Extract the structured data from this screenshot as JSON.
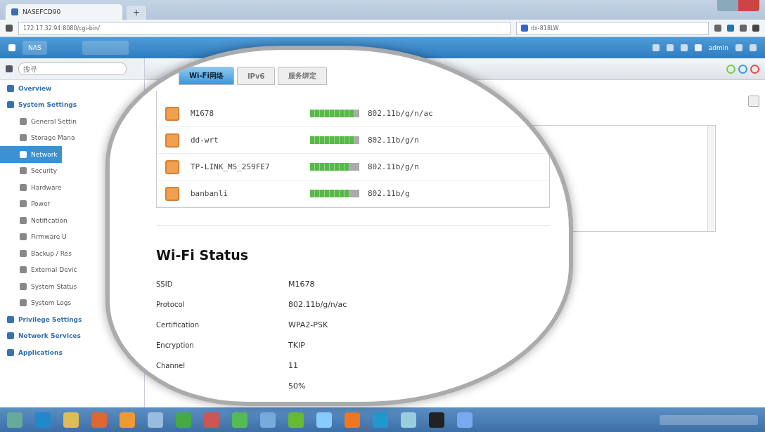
{
  "browser": {
    "tab_title": "NASEFCD90",
    "new_tab": "+",
    "url": "172.17.32.94:8080/cgi-bin/",
    "search": "dx-818LW"
  },
  "appbar": {
    "home": "NAS",
    "user": "admin"
  },
  "sidebar": {
    "search_placeholder": "搜寻",
    "items": [
      {
        "label": "Overview",
        "selected": false
      },
      {
        "label": "System Settings",
        "selected": false,
        "children": [
          {
            "label": "General Settin",
            "selected": false
          },
          {
            "label": "Storage Mana",
            "selected": false
          },
          {
            "label": "Network",
            "selected": true
          },
          {
            "label": "Security",
            "selected": false
          },
          {
            "label": "Hardware",
            "selected": false
          },
          {
            "label": "Power",
            "selected": false
          },
          {
            "label": "Notification",
            "selected": false
          },
          {
            "label": "Firmware U",
            "selected": false
          },
          {
            "label": "Backup / Res",
            "selected": false
          },
          {
            "label": "External Devic",
            "selected": false
          },
          {
            "label": "System Status",
            "selected": false
          },
          {
            "label": "System Logs",
            "selected": false
          }
        ]
      },
      {
        "label": "Privilege Settings",
        "selected": false
      },
      {
        "label": "Network Services",
        "selected": false
      },
      {
        "label": "Applications",
        "selected": false
      }
    ]
  },
  "tabs": [
    {
      "label": "Wi-Fi网络",
      "selected": true
    },
    {
      "label": "IPv6",
      "selected": false
    },
    {
      "label": "服务绑定",
      "selected": false
    }
  ],
  "networks": [
    {
      "name": "M1678",
      "level": 0.9,
      "protocol": "802.11b/g/n/ac"
    },
    {
      "name": "dd-wrt",
      "level": 0.9,
      "protocol": "802.11b/g/n"
    },
    {
      "name": "TP-LINK_MS_259FE7",
      "level": 0.8,
      "protocol": "802.11b/g/n"
    },
    {
      "name": "banbanli",
      "level": 0.8,
      "protocol": "802.11b/g"
    }
  ],
  "wifi_status": {
    "title": "Wi-Fi Status",
    "rows": [
      {
        "label": "SSID",
        "value": "M1678"
      },
      {
        "label": "Protocol",
        "value": "802.11b/g/n/ac"
      },
      {
        "label": "Certification",
        "value": "WPA2-PSK"
      },
      {
        "label": "Encryption",
        "value": "TKIP"
      },
      {
        "label": "Channel",
        "value": "11"
      },
      {
        "value": "50%"
      }
    ]
  }
}
